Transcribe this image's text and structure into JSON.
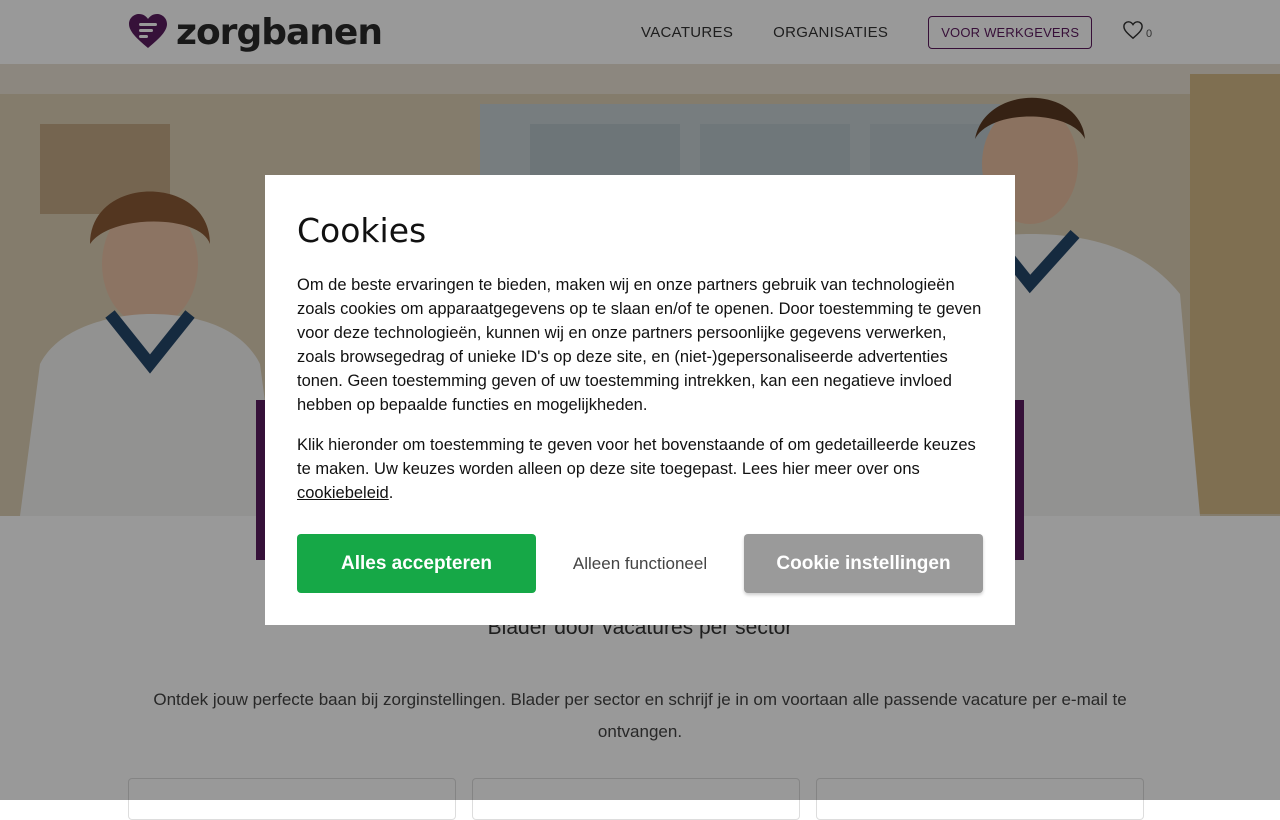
{
  "header": {
    "logo_text": "zorgbanen",
    "nav": {
      "vacatures": "VACATURES",
      "organisaties": "ORGANISATIES",
      "werkgevers": "VOOR WERKGEVERS"
    },
    "favorites_count": "0",
    "favorites_icon": "heart-outline-icon"
  },
  "colors": {
    "brand_purple": "#5b1d60",
    "accept_green": "#16a847",
    "settings_gray": "#9a9a9a"
  },
  "main": {
    "section_title": "Blader door vacatures per sector",
    "section_text": "Ontdek jouw perfecte baan bij zorginstellingen. Blader per sector en schrijf je in om voortaan alle passende vacature per e-mail te ontvangen."
  },
  "cookie_modal": {
    "title": "Cookies",
    "paragraph1": "Om de beste ervaringen te bieden, maken wij en onze partners gebruik van technologieën zoals cookies om apparaatgegevens op te slaan en/of te openen. Door toestemming te geven voor deze technologieën, kunnen wij en onze partners persoonlijke gegevens verwerken, zoals browsegedrag of unieke ID's op deze site, en (niet-)gepersonaliseerde advertenties tonen. Geen toestemming geven of uw toestemming intrekken, kan een negatieve invloed hebben op bepaalde functies en mogelijkheden.",
    "paragraph2": "Klik hieronder om toestemming te geven voor het bovenstaande of om gedetailleerde keuzes te maken. Uw keuzes worden alleen op deze site toegepast. Lees hier meer over ons ",
    "policy_link": "cookiebeleid",
    "paragraph2_end": ".",
    "accept_label": "Alles accepteren",
    "functional_label": "Alleen functioneel",
    "settings_label": "Cookie instellingen"
  }
}
